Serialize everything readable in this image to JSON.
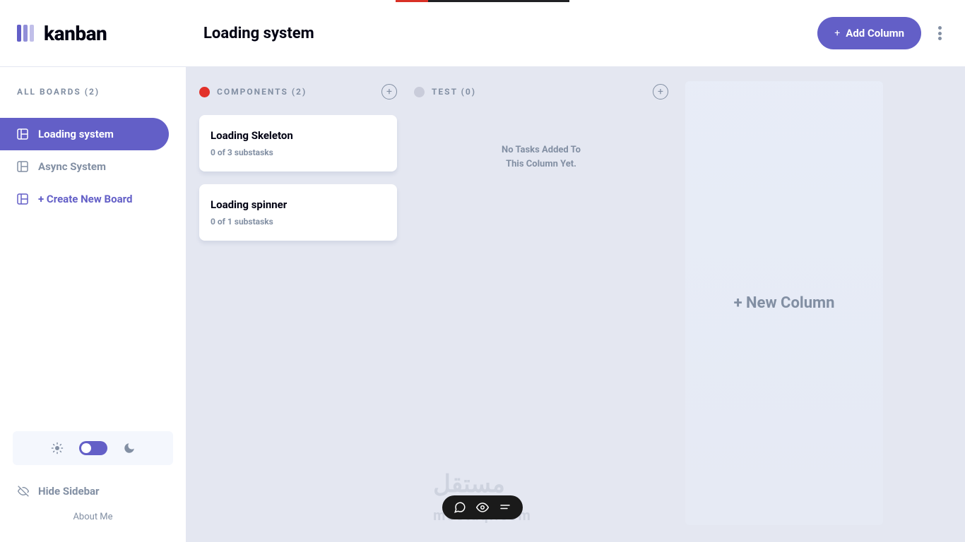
{
  "app": {
    "logo_text": "kanban"
  },
  "header": {
    "board_title": "Loading system",
    "add_column_btn": "Add Column"
  },
  "sidebar": {
    "all_boards_label": "ALL BOARDS (2)",
    "boards": [
      {
        "label": "Loading system",
        "active": true
      },
      {
        "label": "Async System",
        "active": false
      }
    ],
    "create_board_label": "+ Create New Board",
    "hide_sidebar_label": "Hide Sidebar",
    "about_me_label": "About Me"
  },
  "board": {
    "columns": [
      {
        "name": "COMPONENTS",
        "count": 2,
        "header": "COMPONENTS (2)",
        "color": "#e2312a",
        "tasks": [
          {
            "title": "Loading Skeleton",
            "subtasks_text": "0 of 3 substasks"
          },
          {
            "title": "Loading spinner",
            "subtasks_text": "0 of 1 substasks"
          }
        ]
      },
      {
        "name": "TEST",
        "count": 0,
        "header": "TEST (0)",
        "color": "#c9ccda",
        "empty_text_line1": "No Tasks Added To",
        "empty_text_line2": "This Column Yet."
      }
    ],
    "new_column_label": "+ New Column"
  },
  "watermark": {
    "text_main": "مستقل",
    "text_sub": "mostaql.com"
  }
}
